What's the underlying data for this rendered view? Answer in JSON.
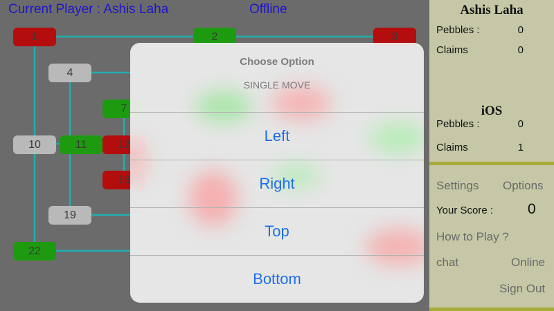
{
  "board": {
    "current_player": "Current Player : Ashis Laha",
    "mode": "Offline",
    "nodes": [
      {
        "label": "1",
        "color": "red"
      },
      {
        "label": "2",
        "color": "green"
      },
      {
        "label": "3",
        "color": "red"
      },
      {
        "label": "4",
        "color": "gray"
      },
      {
        "label": "7",
        "color": "green"
      },
      {
        "label": "10",
        "color": "gray"
      },
      {
        "label": "11",
        "color": "green"
      },
      {
        "label": "12",
        "color": "red"
      },
      {
        "label": "16",
        "color": "red"
      },
      {
        "label": "19",
        "color": "gray"
      },
      {
        "label": "22",
        "color": "green"
      }
    ]
  },
  "players": [
    {
      "name": "Ashis Laha",
      "pebbles_label": "Pebbles :",
      "pebbles": "0",
      "claims_label": "Claims",
      "claims": "0"
    },
    {
      "name": "iOS",
      "pebbles_label": "Pebbles :",
      "pebbles": "0",
      "claims_label": "Claims",
      "claims": "1"
    }
  ],
  "menu": {
    "settings": "Settings",
    "options": "Options",
    "score_label": "Your Score :",
    "score_value": "0",
    "how_to_play": "How to Play ?",
    "chat": "chat",
    "online": "Online",
    "sign_out": "Sign Out"
  },
  "sheet": {
    "title": "Choose Option",
    "subtitle": "SINGLE MOVE",
    "options": [
      "Left",
      "Right",
      "Top",
      "Bottom"
    ]
  },
  "colors": {
    "board_bg": "#6b6b6b",
    "line": "#20aeb0",
    "red_node": "#b40d0d",
    "green_node": "#1e9a10",
    "gray_node": "#b9b9b9",
    "panel_bg": "#c6c7a6",
    "panel_divider": "#a8aa3a",
    "status_text": "#1d17c9",
    "option_text": "#1e6fe6"
  }
}
